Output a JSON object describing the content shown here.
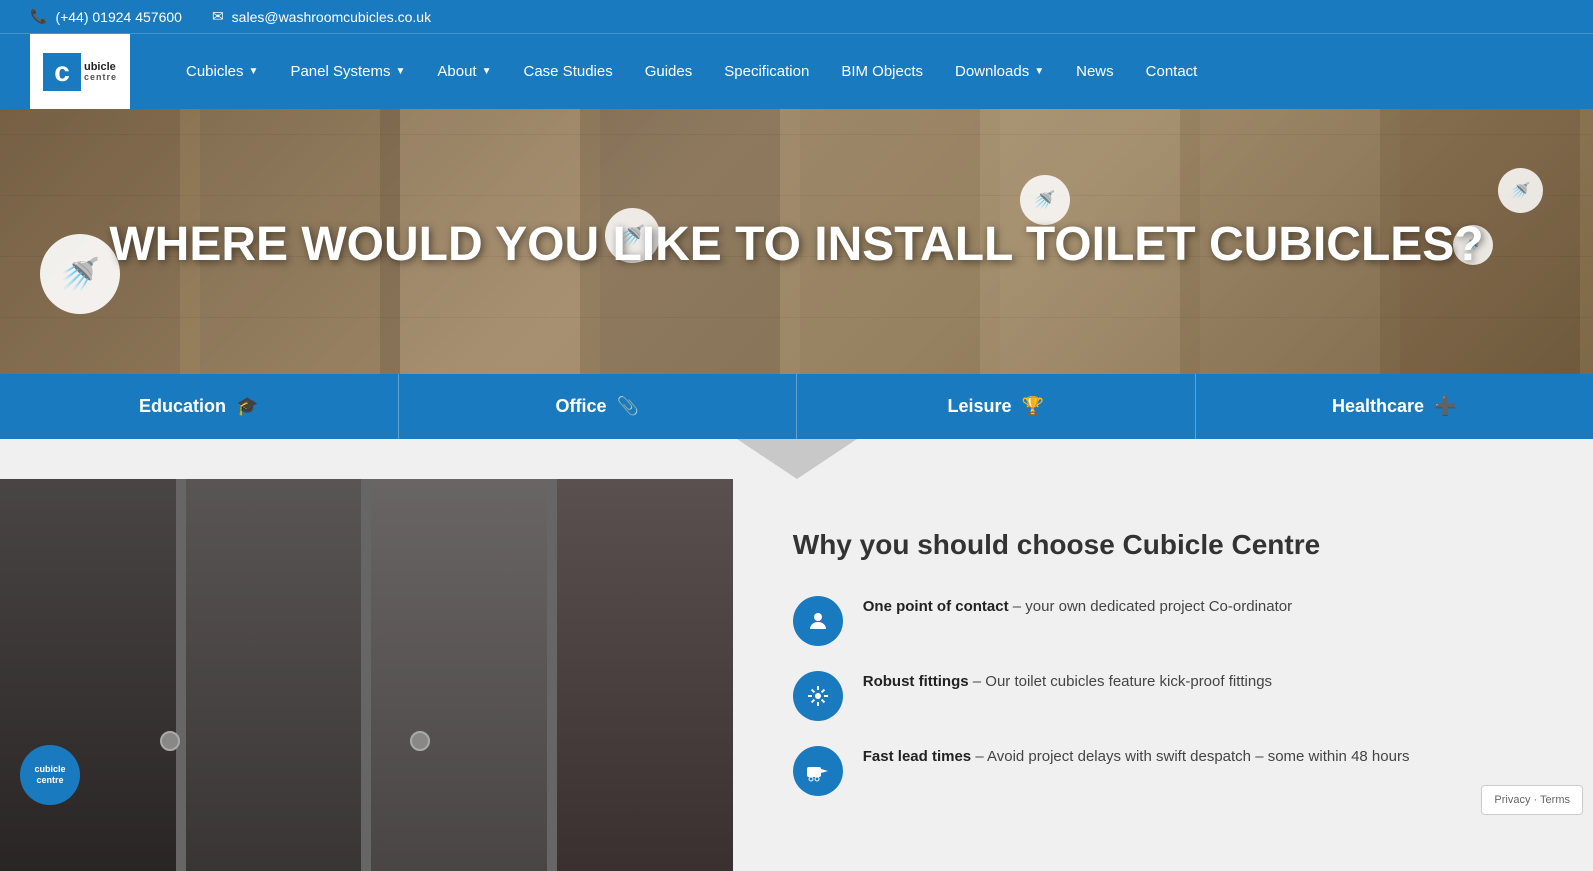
{
  "topbar": {
    "phone": "(+44) 01924 457600",
    "email": "sales@washroomcubicles.co.uk"
  },
  "nav": {
    "logo_line1": "cubicle",
    "logo_line2": "centre",
    "items": [
      {
        "label": "Cubicles",
        "has_dropdown": true
      },
      {
        "label": "Panel Systems",
        "has_dropdown": true
      },
      {
        "label": "About",
        "has_dropdown": true
      },
      {
        "label": "Case Studies",
        "has_dropdown": false
      },
      {
        "label": "Guides",
        "has_dropdown": false
      },
      {
        "label": "Specification",
        "has_dropdown": false
      },
      {
        "label": "BIM Objects",
        "has_dropdown": false
      },
      {
        "label": "Downloads",
        "has_dropdown": true
      },
      {
        "label": "News",
        "has_dropdown": false
      },
      {
        "label": "Contact",
        "has_dropdown": false
      }
    ]
  },
  "hero": {
    "title": "WHERE WOULD YOU LIKE TO INSTALL TOILET CUBICLES?",
    "buttons": [
      {
        "label": "Education",
        "icon": "🎓"
      },
      {
        "label": "Office",
        "icon": "📎"
      },
      {
        "label": "Leisure",
        "icon": "🏆"
      },
      {
        "label": "Healthcare",
        "icon": "➕"
      }
    ]
  },
  "why_section": {
    "title": "Why you should choose Cubicle Centre",
    "features": [
      {
        "icon": "👤",
        "text_bold": "One point of contact",
        "text_rest": " – your own dedicated project Co-ordinator"
      },
      {
        "icon": "⚙",
        "text_bold": "Robust fittings",
        "text_rest": " – Our toilet cubicles feature kick-proof fittings"
      },
      {
        "icon": "🚚",
        "text_bold": "Fast lead times",
        "text_rest": " – Avoid project delays with swift despatch – some within 48 hours"
      }
    ]
  },
  "cookie": {
    "label": "cubicle\ncentre"
  },
  "privacy": {
    "label": "Privacy · Terms"
  },
  "colors": {
    "primary_blue": "#1a7abf",
    "dark_blue": "#155f9a",
    "bg_light": "#f0f0f0"
  }
}
